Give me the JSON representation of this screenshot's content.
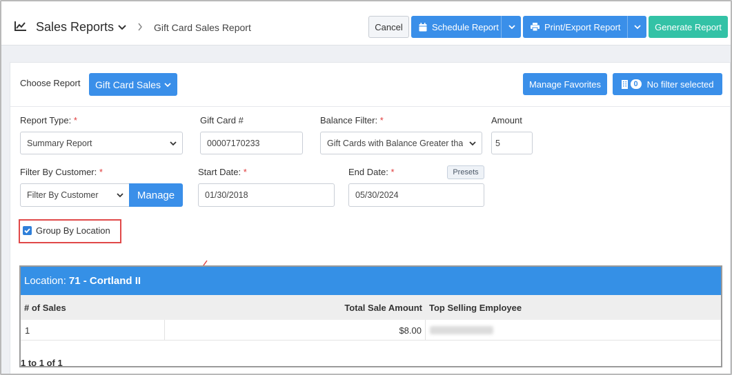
{
  "header": {
    "title": "Sales Reports",
    "breadcrumb": "Gift Card Sales Report",
    "cancel_label": "Cancel",
    "schedule_label": "Schedule Report",
    "print_label": "Print/Export Report",
    "generate_label": "Generate Report"
  },
  "toolbar": {
    "choose_label": "Choose Report",
    "report_selected": "Gift Card Sales",
    "favorites_label": "Manage Favorites",
    "filter_count": "0",
    "filter_label": "No filter selected"
  },
  "form": {
    "report_type": {
      "label": "Report Type:",
      "required": "*",
      "value": "Summary Report"
    },
    "gift_card": {
      "label": "Gift Card #",
      "value": "00007170233"
    },
    "balance_filter": {
      "label": "Balance Filter:",
      "required": "*",
      "value": "Gift Cards with Balance Greater tha"
    },
    "amount": {
      "label": "Amount",
      "value": "5"
    },
    "customer": {
      "label": "Filter By Customer:",
      "required": "*",
      "value": "Filter By Customer",
      "manage_label": "Manage"
    },
    "start_date": {
      "label": "Start Date:",
      "required": "*",
      "value": "01/30/2018"
    },
    "end_date": {
      "label": "End Date:",
      "required": "*",
      "value": "05/30/2024"
    },
    "presets_label": "Presets",
    "group_by_location": {
      "label": "Group By Location",
      "checked": true
    }
  },
  "results": {
    "location_prefix": "Location:",
    "location_name": "71 - Cortland II",
    "columns": [
      "# of Sales",
      "Total Sale Amount",
      "Top Selling Employee"
    ],
    "rows": [
      {
        "sales": "1",
        "amount": "$8.00"
      }
    ],
    "pager": "1 to 1 of 1"
  },
  "colors": {
    "primary": "#3a8fe9",
    "success": "#33c2a6",
    "header_bar": "#3590e6",
    "highlight": "#e04848"
  }
}
